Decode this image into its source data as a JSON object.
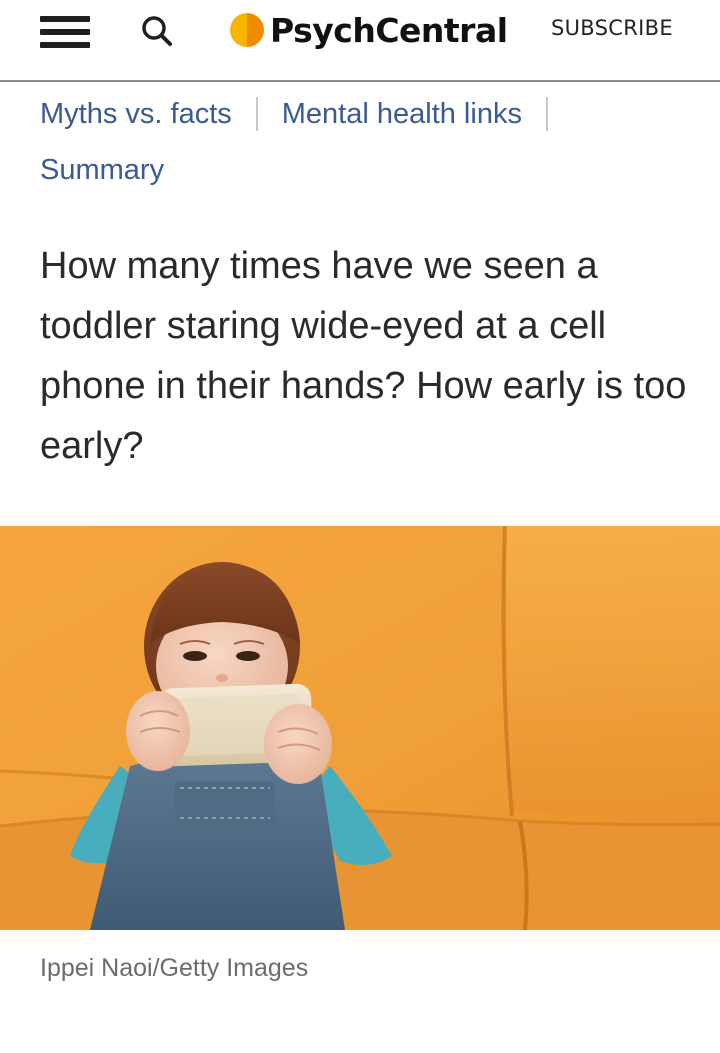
{
  "header": {
    "menu_icon": "hamburger-menu-icon",
    "search_icon": "search-icon",
    "logo_text": "PsychCentral",
    "subscribe_label": "SUBSCRIBE",
    "brand_color": "#f5a623"
  },
  "toc": {
    "links": [
      {
        "label": "Myths vs. facts"
      },
      {
        "label": "Mental health links"
      },
      {
        "label": "Summary"
      }
    ],
    "link_color": "#3a5a94"
  },
  "article": {
    "intro": "How many times have we seen a toddler staring wide-eyed at a cell phone in their hands? How early is too early?"
  },
  "hero_image": {
    "caption": "Ippei Naoi/Getty Images"
  }
}
